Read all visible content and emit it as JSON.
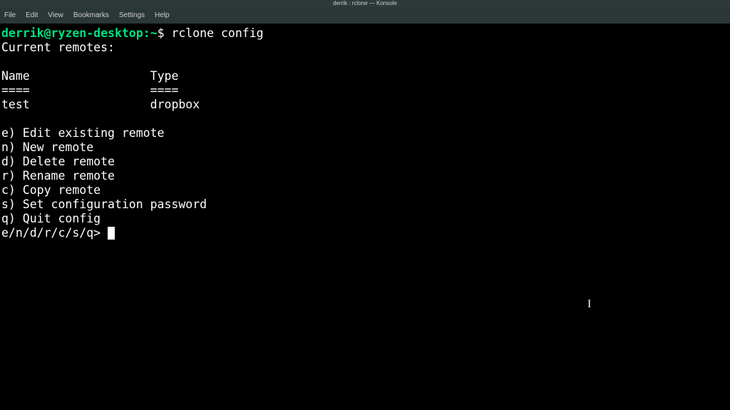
{
  "window": {
    "title": "derrik : rclone — Konsole"
  },
  "menubar": {
    "items": [
      "File",
      "Edit",
      "View",
      "Bookmarks",
      "Settings",
      "Help"
    ]
  },
  "prompt": {
    "user_host": "derrik@ryzen-desktop",
    "colon": ":",
    "path": "~",
    "dollar": "$",
    "command": "rclone config"
  },
  "output": {
    "current_remotes_label": "Current remotes:",
    "blank": "",
    "name_header": "Name",
    "type_header": "Type",
    "name_underline": "====",
    "type_underline": "====",
    "remote_name": "test",
    "remote_type": "dropbox",
    "options": [
      "e) Edit existing remote",
      "n) New remote",
      "d) Delete remote",
      "r) Rename remote",
      "c) Copy remote",
      "s) Set configuration password",
      "q) Quit config"
    ],
    "input_prompt": "e/n/d/r/c/s/q> "
  }
}
